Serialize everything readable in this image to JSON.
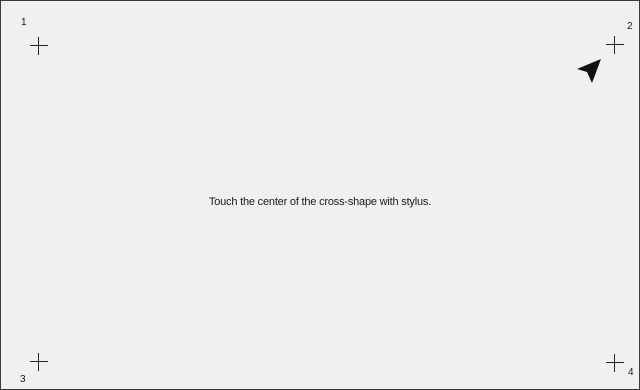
{
  "calibration": {
    "instruction": "Touch the center of the cross-shape with stylus.",
    "targets": [
      {
        "label": "1"
      },
      {
        "label": "2"
      },
      {
        "label": "3"
      },
      {
        "label": "4"
      }
    ],
    "active_target": "2",
    "pointer_icon": "arrow-pointer-icon"
  }
}
